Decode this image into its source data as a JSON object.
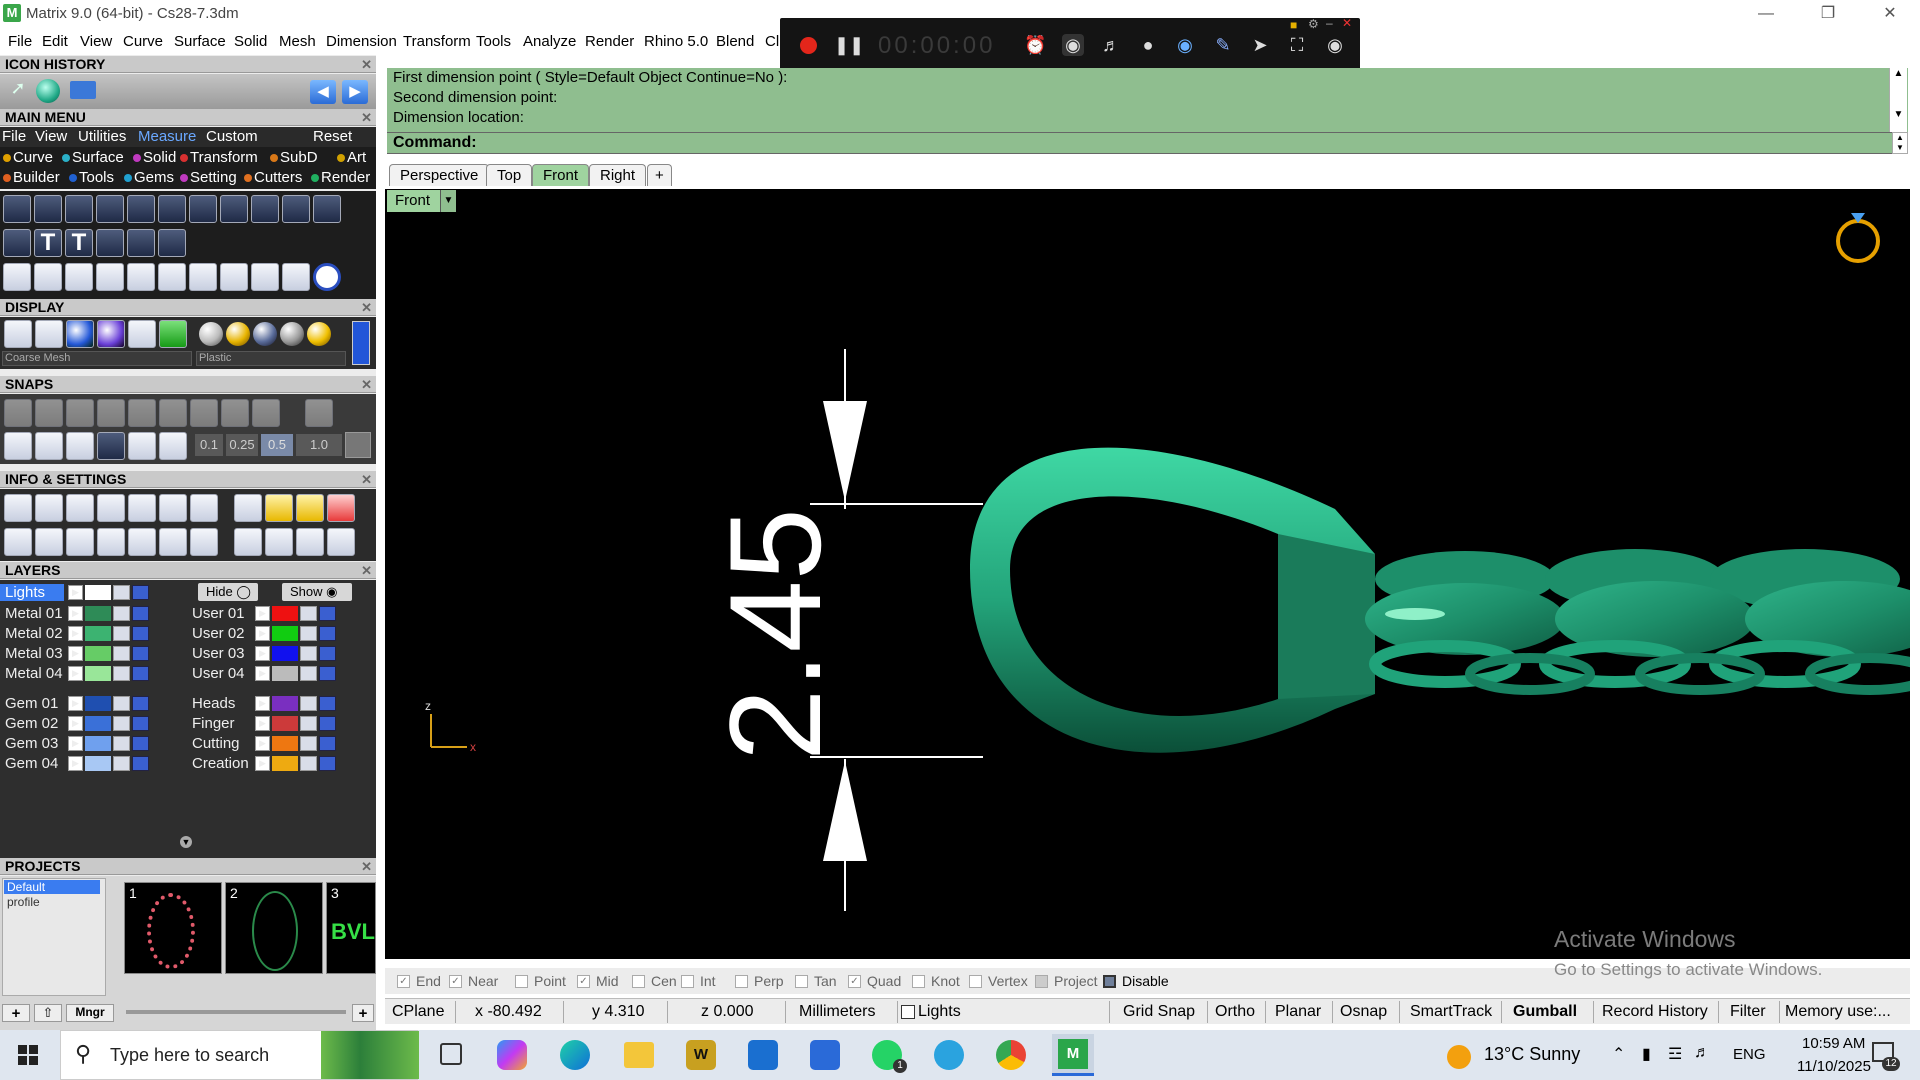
{
  "window": {
    "title": "Matrix 9.0 (64-bit) - Cs28-7.3dm",
    "app_icon": "matrix-icon"
  },
  "menu": [
    "File",
    "Edit",
    "View",
    "Curve",
    "Surface",
    "Solid",
    "Mesh",
    "Dimension",
    "Transform",
    "Tools",
    "Analyze",
    "Render",
    "Rhino 5.0",
    "Blend",
    "Cl"
  ],
  "panels": {
    "icon_history": "ICON HISTORY",
    "main_menu": "MAIN MENU",
    "display": "DISPLAY",
    "snaps": "SNAPS",
    "info_settings": "INFO & SETTINGS",
    "layers": "LAYERS",
    "projects": "PROJECTS"
  },
  "main_menu_tabs": [
    "File",
    "View",
    "Utilities",
    "Measure",
    "Custom",
    "Reset"
  ],
  "main_menu_cats1": [
    {
      "label": "Curve",
      "color": "#e0a000"
    },
    {
      "label": "Surface",
      "color": "#2bb0c8"
    },
    {
      "label": "Solid",
      "color": "#c03ac0"
    },
    {
      "label": "Transform",
      "color": "#d83030"
    },
    {
      "label": "SubD",
      "color": "#d87818"
    },
    {
      "label": "Art",
      "color": "#d0a000"
    }
  ],
  "main_menu_cats2": [
    {
      "label": "Builder",
      "color": "#e06020"
    },
    {
      "label": "Tools",
      "color": "#2060d0"
    },
    {
      "label": "Gems",
      "color": "#20a0d0"
    },
    {
      "label": "Setting",
      "color": "#c03ac0"
    },
    {
      "label": "Cutters",
      "color": "#e07020"
    },
    {
      "label": "Render",
      "color": "#20b060"
    }
  ],
  "display": {
    "mesh_select": "Coarse Mesh",
    "material_select": "Plastic"
  },
  "snaps_values": [
    "0.1",
    "0.25",
    "0.5",
    "1.0"
  ],
  "layers": {
    "hide_label": "Hide",
    "show_label": "Show",
    "left": [
      {
        "name": "Lights",
        "color": "#ffffff",
        "selected": true
      },
      {
        "name": "Metal 01",
        "color": "#2e8b57"
      },
      {
        "name": "Metal 02",
        "color": "#3cb371"
      },
      {
        "name": "Metal 03",
        "color": "#66cc66"
      },
      {
        "name": "Metal 04",
        "color": "#99e699"
      },
      {
        "name": "Gem 01",
        "color": "#1f4fb0"
      },
      {
        "name": "Gem 02",
        "color": "#3a70d8"
      },
      {
        "name": "Gem 03",
        "color": "#6fa0ee"
      },
      {
        "name": "Gem 04",
        "color": "#a8c8f4"
      }
    ],
    "right": [
      {
        "name": "User 01",
        "color": "#ee1111"
      },
      {
        "name": "User 02",
        "color": "#11cc11"
      },
      {
        "name": "User 03",
        "color": "#1111ee"
      },
      {
        "name": "User 04",
        "color": "#bbbbbb"
      },
      {
        "name": "Heads",
        "color": "#7a2fc0"
      },
      {
        "name": "Finger",
        "color": "#cc3a3a"
      },
      {
        "name": "Cutting",
        "color": "#ee7711"
      },
      {
        "name": "Creation",
        "color": "#eeaa11"
      }
    ]
  },
  "projects": {
    "profile": "Default profile",
    "slots": [
      "1",
      "2",
      "3"
    ],
    "mngr": "Mngr"
  },
  "command": {
    "line1": "First dimension point ( Style=Default  Object  Continue=No ):",
    "line2": "Second dimension point:",
    "line3": "Dimension location:",
    "prompt": "Command:"
  },
  "viewport_tabs": [
    "Perspective",
    "Top",
    "Front",
    "Right"
  ],
  "active_viewport": "Front",
  "viewport": {
    "label": "Front",
    "dimension_text": "2.45",
    "axis_z": "z",
    "axis_x": "x",
    "watermark1": "Activate Windows",
    "watermark2": "Go to Settings to activate Windows."
  },
  "osnaps": [
    {
      "label": "End",
      "checked": true
    },
    {
      "label": "Near",
      "checked": true
    },
    {
      "label": "Point",
      "checked": false
    },
    {
      "label": "Mid",
      "checked": true
    },
    {
      "label": "Cen",
      "checked": false
    },
    {
      "label": "Int",
      "checked": false
    },
    {
      "label": "Perp",
      "checked": false
    },
    {
      "label": "Tan",
      "checked": false
    },
    {
      "label": "Quad",
      "checked": true
    },
    {
      "label": "Knot",
      "checked": false
    },
    {
      "label": "Vertex",
      "checked": false
    },
    {
      "label": "Project",
      "checked": false
    },
    {
      "label": "Disable",
      "checked": false
    }
  ],
  "status": {
    "cplane": "CPlane",
    "x": "x -80.492",
    "y": "y 4.310",
    "z": "z 0.000",
    "units": "Millimeters",
    "layer": "Lights",
    "grid_snap": "Grid Snap",
    "ortho": "Ortho",
    "planar": "Planar",
    "osnap": "Osnap",
    "smarttrack": "SmartTrack",
    "gumball": "Gumball",
    "record_history": "Record History",
    "filter": "Filter",
    "memory": "Memory use:..."
  },
  "recorder": {
    "timer": "00:00:00"
  },
  "taskbar": {
    "search_placeholder": "Type here to search",
    "weather": "13°C  Sunny",
    "lang": "ENG",
    "time": "10:59 AM",
    "date": "11/10/2025",
    "notif_count": "12",
    "whatsapp_badge": "1"
  }
}
